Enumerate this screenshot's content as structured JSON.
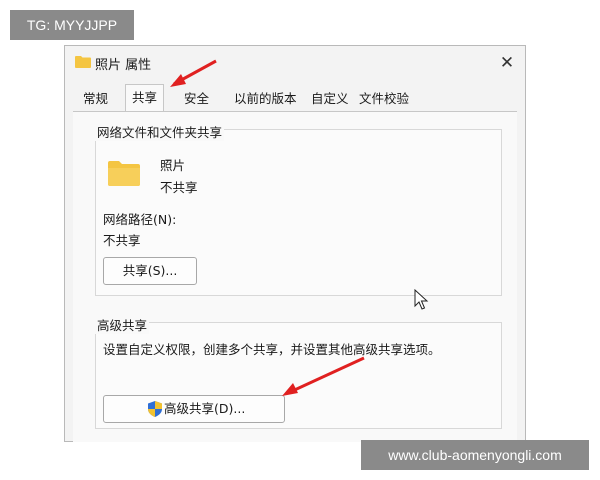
{
  "watermarks": {
    "top_left": "TG: MYYJJPP",
    "bottom_right": "www.club-aomenyongli.com"
  },
  "window": {
    "title": "照片 属性",
    "close_glyph": "✕",
    "icon": "folder-icon"
  },
  "tabs": [
    {
      "label": "常规",
      "active": false
    },
    {
      "label": "共享",
      "active": true
    },
    {
      "label": "安全",
      "active": false
    },
    {
      "label": "以前的版本",
      "active": false
    },
    {
      "label": "自定义",
      "active": false
    },
    {
      "label": "文件校验",
      "active": false
    }
  ],
  "network_group": {
    "title": "网络文件和文件夹共享",
    "folder_name": "照片",
    "folder_status": "不共享",
    "path_label": "网络路径(N):",
    "path_value": "不共享",
    "share_button": "共享(S)..."
  },
  "advanced_group": {
    "title": "高级共享",
    "description": "设置自定义权限，创建多个共享，并设置其他高级共享选项。",
    "button": "高级共享(D)...",
    "button_icon": "uac-shield-icon"
  },
  "colors": {
    "annotation_arrow": "#e02020",
    "folder": "#f4c542"
  }
}
